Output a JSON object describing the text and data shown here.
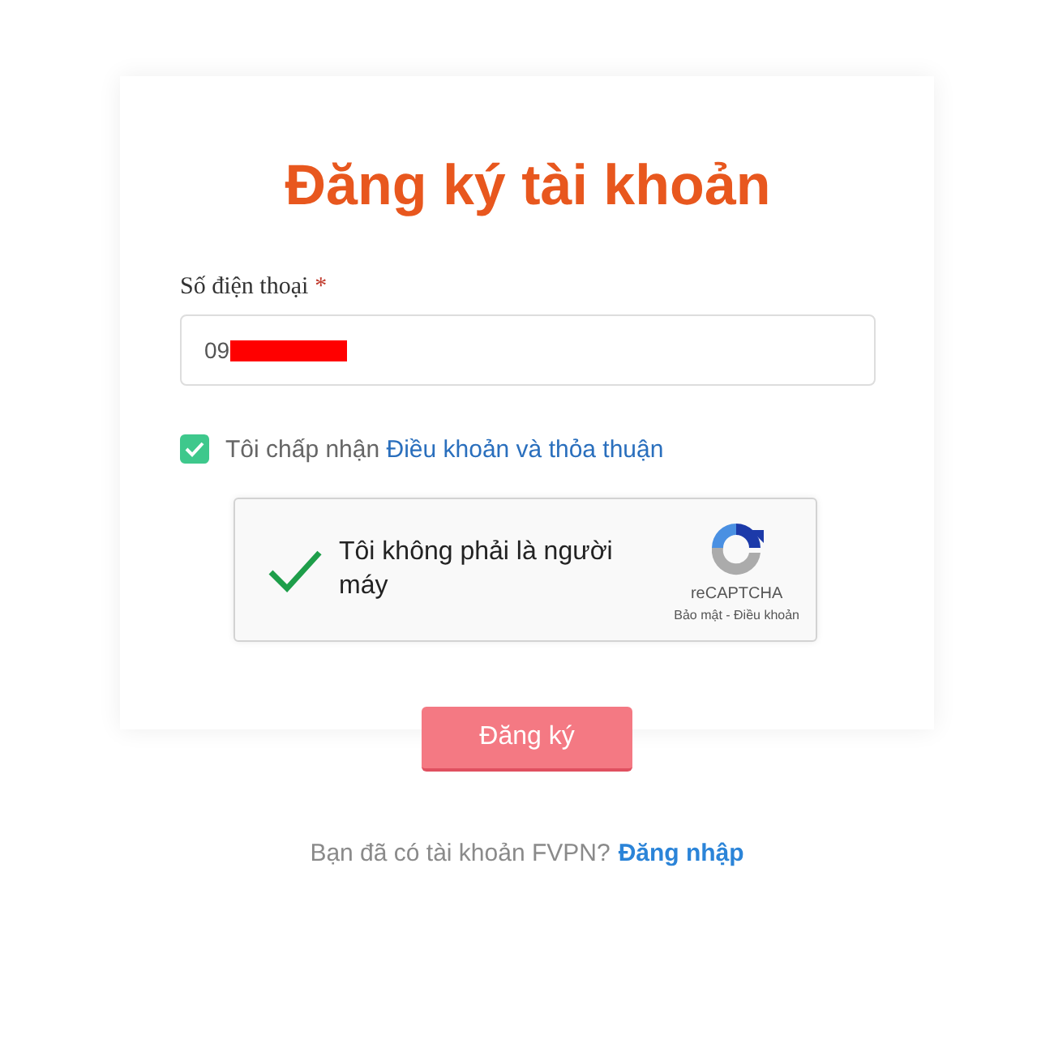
{
  "title": "Đăng ký tài khoản",
  "phone_field": {
    "label": "Số điện thoại",
    "required_mark": "*",
    "value": "09",
    "redacted": true
  },
  "terms": {
    "checked": true,
    "text": "Tôi chấp nhận",
    "link": "Điều khoản và thỏa thuận"
  },
  "captcha": {
    "checked": true,
    "text": "Tôi không phải là người máy",
    "brand": "reCAPTCHA",
    "footer": "Bảo mật - Điều khoản"
  },
  "submit_button": "Đăng ký",
  "login_prompt": {
    "text": "Bạn đã có tài khoản FVPN?",
    "link": "Đăng nhập"
  }
}
